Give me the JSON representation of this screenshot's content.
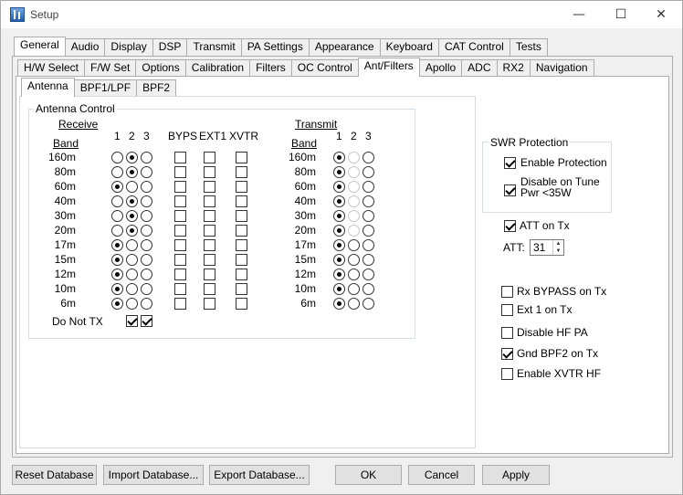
{
  "window": {
    "title": "Setup",
    "minimize": "—",
    "maximize": "☐",
    "close": "✕"
  },
  "main_tabs": [
    "General",
    "Audio",
    "Display",
    "DSP",
    "Transmit",
    "PA Settings",
    "Appearance",
    "Keyboard",
    "CAT Control",
    "Tests"
  ],
  "main_tab_active": "General",
  "sub_tabs": [
    "H/W Select",
    "F/W Set",
    "Options",
    "Calibration",
    "Filters",
    "OC Control",
    "Ant/Filters",
    "Apollo",
    "ADC",
    "RX2",
    "Navigation"
  ],
  "sub_tab_active": "Ant/Filters",
  "inner_tabs": [
    "Antenna",
    "BPF1/LPF",
    "BPF2"
  ],
  "inner_tab_active": "Antenna",
  "antenna": {
    "group_title": "Antenna Control",
    "receive_label": "Receive",
    "transmit_label": "Transmit",
    "band_label": "Band",
    "ant_cols": [
      "1",
      "2",
      "3"
    ],
    "extra_cols": [
      "BYPS",
      "EXT1",
      "XVTR"
    ],
    "rx_bands": [
      {
        "band": "160m",
        "sel": 2
      },
      {
        "band": "80m",
        "sel": 2
      },
      {
        "band": "60m",
        "sel": 1
      },
      {
        "band": "40m",
        "sel": 2
      },
      {
        "band": "30m",
        "sel": 2
      },
      {
        "band": "20m",
        "sel": 2
      },
      {
        "band": "17m",
        "sel": 1
      },
      {
        "band": "15m",
        "sel": 1
      },
      {
        "band": "12m",
        "sel": 1
      },
      {
        "band": "10m",
        "sel": 1
      },
      {
        "band": "6m",
        "sel": 1
      }
    ],
    "tx_bands": [
      {
        "band": "160m",
        "sel": 1
      },
      {
        "band": "80m",
        "sel": 1
      },
      {
        "band": "60m",
        "sel": 1
      },
      {
        "band": "40m",
        "sel": 1
      },
      {
        "band": "30m",
        "sel": 1
      },
      {
        "band": "20m",
        "sel": 1
      },
      {
        "band": "17m",
        "sel": 1
      },
      {
        "band": "15m",
        "sel": 1
      },
      {
        "band": "12m",
        "sel": 1
      },
      {
        "band": "10m",
        "sel": 1
      },
      {
        "band": "6m",
        "sel": 1
      }
    ],
    "do_not_tx_label": "Do Not TX",
    "do_not_tx": [
      true,
      true
    ]
  },
  "swr": {
    "group_title": "SWR Protection",
    "enable_label": "Enable Protection",
    "enable": true,
    "disable_tune_label_1": "Disable on Tune",
    "disable_tune_label_2": "Pwr <35W",
    "disable_tune": true
  },
  "att": {
    "att_on_tx_label": "ATT on Tx",
    "att_on_tx": true,
    "att_label": "ATT:",
    "att_value": "31"
  },
  "options": [
    {
      "label": "Rx BYPASS on Tx",
      "checked": false
    },
    {
      "label": "Ext 1 on Tx",
      "checked": false
    },
    {
      "label": "Disable HF PA",
      "checked": false
    },
    {
      "label": "Gnd BPF2 on Tx",
      "checked": true
    },
    {
      "label": "Enable XVTR HF",
      "checked": false
    }
  ],
  "buttons": {
    "reset": "Reset Database",
    "import": "Import Database...",
    "export": "Export Database...",
    "ok": "OK",
    "cancel": "Cancel",
    "apply": "Apply"
  }
}
